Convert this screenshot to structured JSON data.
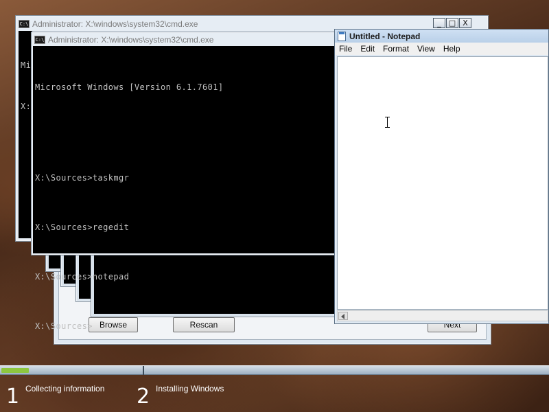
{
  "back_window": {
    "title": "Administrator: X:\\windows\\system32\\cmd.exe",
    "console_peek_1": "Mi",
    "console_peek_2": "X:",
    "icon": "cmd-icon"
  },
  "front_console": {
    "title": "Administrator: X:\\windows\\system32\\cmd.exe",
    "icon": "cmd-icon",
    "lines": [
      "Microsoft Windows [Version 6.1.7601]",
      "",
      "X:\\Sources>taskmgr",
      "X:\\Sources>regedit",
      "X:\\Sources>notepad",
      "X:\\Sources>"
    ]
  },
  "setup_window": {
    "browse_label": "Browse",
    "rescan_label": "Rescan",
    "next_label": "Next"
  },
  "notepad": {
    "title": "Untitled - Notepad",
    "menu": [
      "File",
      "Edit",
      "Format",
      "View",
      "Help"
    ],
    "text": "",
    "icon": "notepad-icon"
  },
  "window_controls": {
    "minimize": "_",
    "maximize": "□",
    "close": "X"
  },
  "progress": {
    "steps": [
      {
        "number": "1",
        "label": "Collecting information"
      },
      {
        "number": "2",
        "label": "Installing Windows"
      }
    ],
    "fill_fraction": 0.2
  },
  "colors": {
    "progress_fill": "#8dc63f",
    "console_bg": "#000000",
    "console_text": "#c0c0c0"
  }
}
